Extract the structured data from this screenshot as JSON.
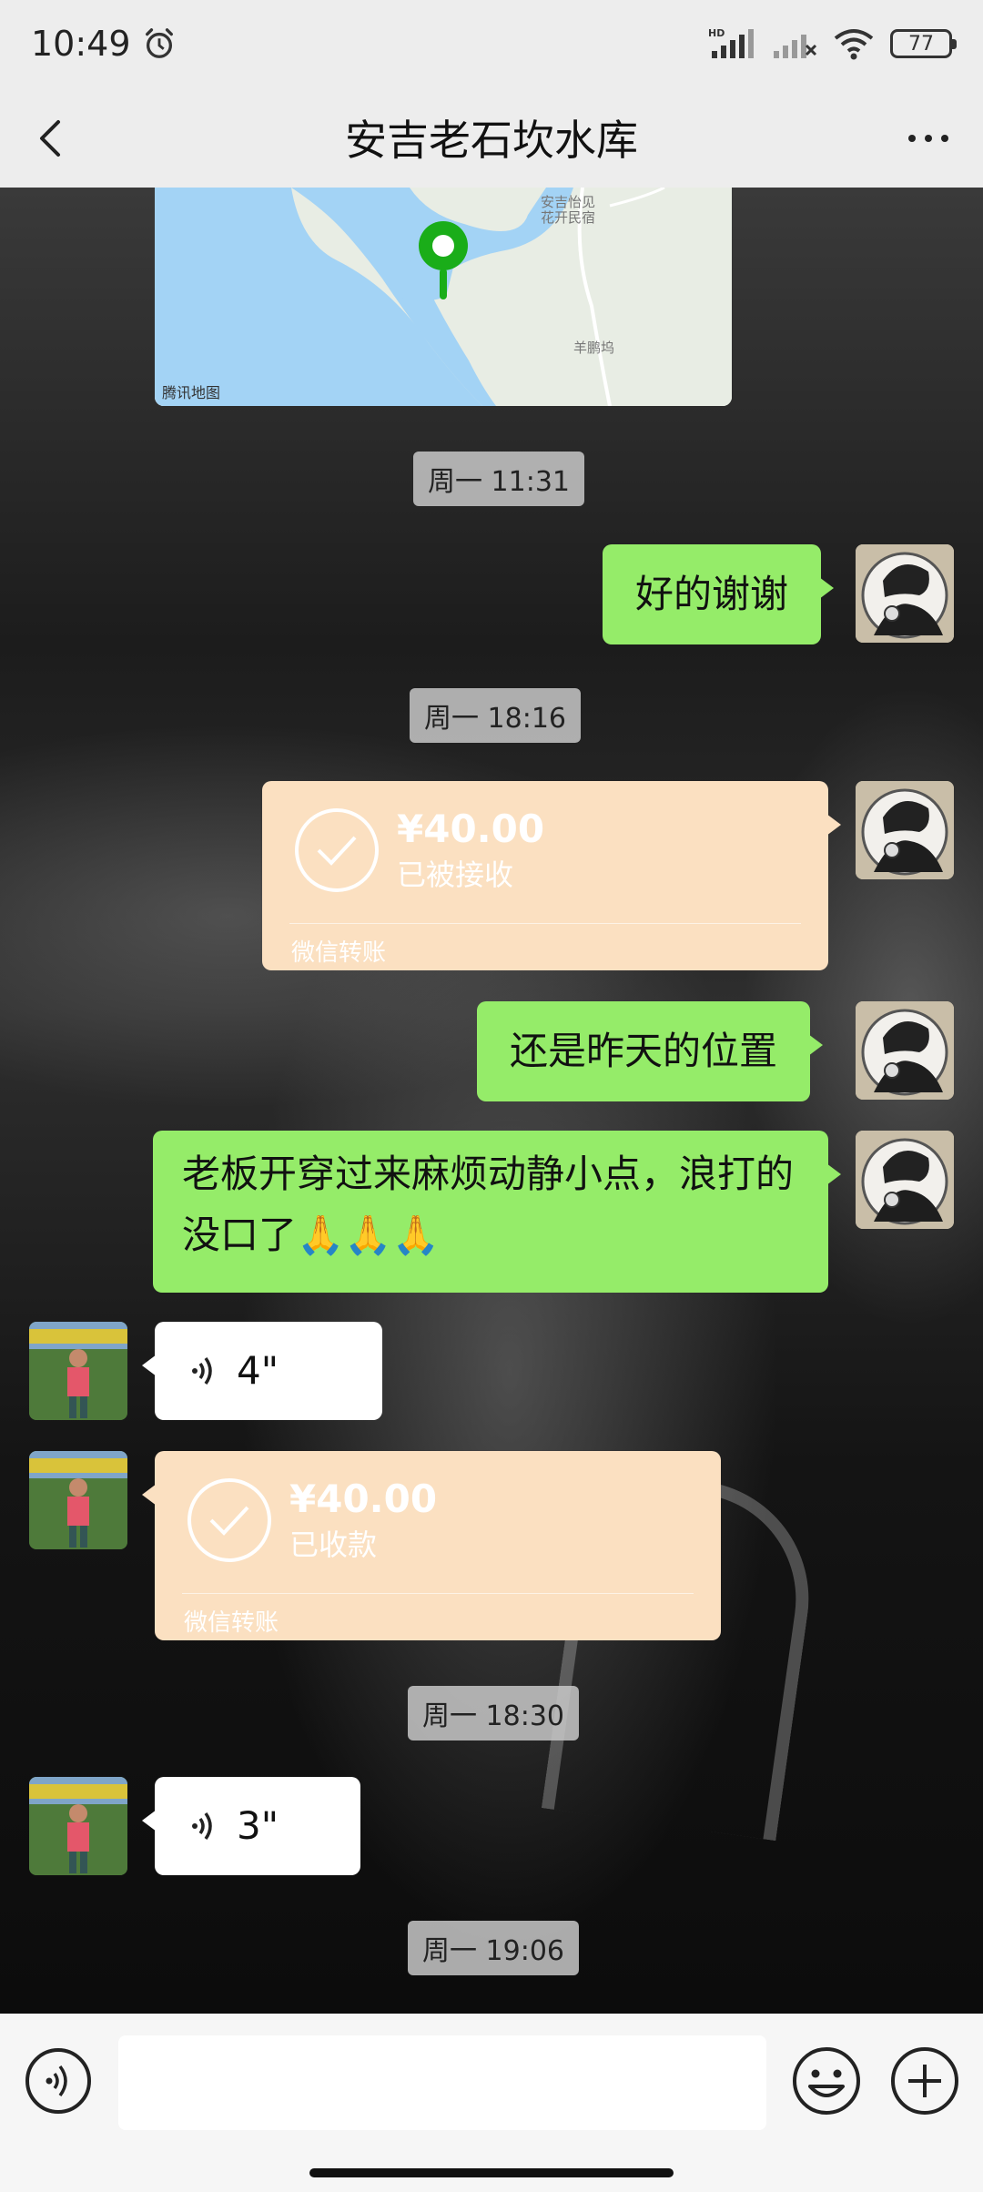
{
  "status_bar": {
    "time": "10:49",
    "battery": "77"
  },
  "header": {
    "title": "安吉老石坎水库"
  },
  "map": {
    "poi": "安吉怡见\n花开民宿",
    "road": "羊鹏坞",
    "brand": "腾讯地图"
  },
  "messages": {
    "ts1": "周一 11:31",
    "msg1": "好的谢谢",
    "ts2": "周一 18:16",
    "transfer1": {
      "amount": "¥40.00",
      "status": "已被接收",
      "footer": "微信转账"
    },
    "msg2": "还是昨天的位置",
    "msg3": "老板开穿过来麻烦动静小点，浪打的没口了🙏🙏🙏",
    "voice1": "4\"",
    "transfer2": {
      "amount": "¥40.00",
      "status": "已收款",
      "footer": "微信转账"
    },
    "ts3": "周一 18:30",
    "voice2": "3\"",
    "ts4": "周一 19:06"
  },
  "colors": {
    "bubble_green": "#95ec69",
    "transfer_orange": "#fbe0c1",
    "map_pin": "#1aad19"
  }
}
